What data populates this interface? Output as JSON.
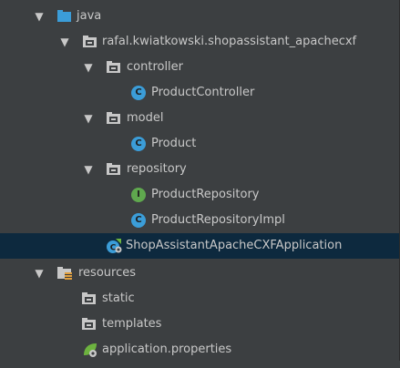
{
  "tree": {
    "java": "java",
    "package": "rafal.kwiatkowski.shopassistant_apachecxf",
    "controller": "controller",
    "product_controller": "ProductController",
    "model": "model",
    "product": "Product",
    "repository": "repository",
    "product_repository": "ProductRepository",
    "product_repository_impl": "ProductRepositoryImpl",
    "application": "ShopAssistantApacheCXFApplication",
    "resources": "resources",
    "static": "static",
    "templates": "templates",
    "properties": "application.properties"
  },
  "icons": {
    "class_letter": "C",
    "interface_letter": "I",
    "expanded_arrow": "▼"
  },
  "colors": {
    "background": "#3c3f41",
    "selection": "#0d293e",
    "source_folder": "#3b9dd8",
    "class": "#3b9dd8",
    "interface": "#5fa84e",
    "spring": "#6db33f"
  }
}
